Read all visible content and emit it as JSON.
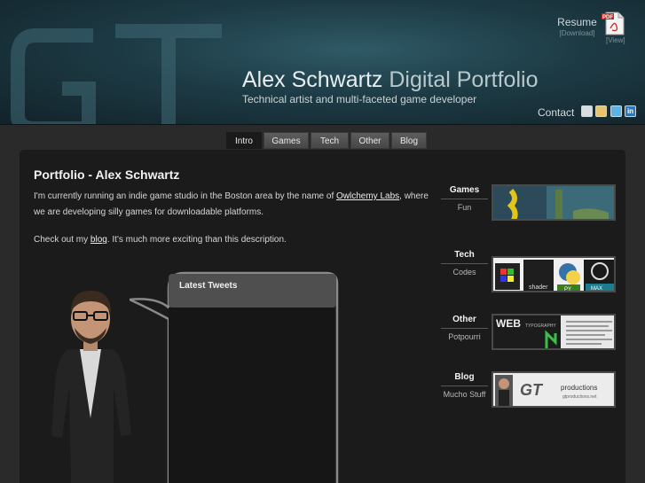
{
  "header": {
    "title_name": "Alex Schwartz",
    "title_rest": "Digital Portfolio",
    "subtitle": "Technical artist and multi-faceted game developer",
    "resume": {
      "label": "Resume",
      "download": "[Download]",
      "view": "[View]"
    },
    "pdf_badge": "PDF",
    "contact_label": "Contact",
    "contact_icons": [
      "email-icon",
      "aim-icon",
      "twitter-icon",
      "linkedin-icon"
    ],
    "linkedin_glyph": "in"
  },
  "nav": {
    "tabs": [
      {
        "label": "Intro",
        "active": true
      },
      {
        "label": "Games"
      },
      {
        "label": "Tech"
      },
      {
        "label": "Other"
      },
      {
        "label": "Blog"
      }
    ]
  },
  "main": {
    "title": "Portfolio - Alex Schwartz",
    "intro_before": "I'm currently running an indie game studio in the Boston area by the name of ",
    "intro_link": "Owlchemy Labs",
    "intro_after": ", where we are developing silly games for downloadable platforms.",
    "blog_before": "Check out my ",
    "blog_link": "blog",
    "blog_after": ". It's much more exciting than this description.",
    "tweets_header": "Latest Tweets"
  },
  "sidebar": [
    {
      "label": "Games",
      "sub": "Fun"
    },
    {
      "label": "Tech",
      "sub": "Codes",
      "thumb_text": "shader",
      "thumb_tags": [
        "PY",
        "MAX"
      ]
    },
    {
      "label": "Other",
      "sub": "Potpourri",
      "thumb_text": "WEB",
      "thumb_small": "TYPOGRAPHY"
    },
    {
      "label": "Blog",
      "sub": "Mucho Stuff",
      "thumb_logo": "GT",
      "thumb_text": "productions",
      "thumb_small": "gtproductions.net"
    }
  ],
  "colors": {
    "header_teal": "#1d3b45",
    "panel": "#1b1b1b",
    "page_bg": "#2a2a2a"
  }
}
